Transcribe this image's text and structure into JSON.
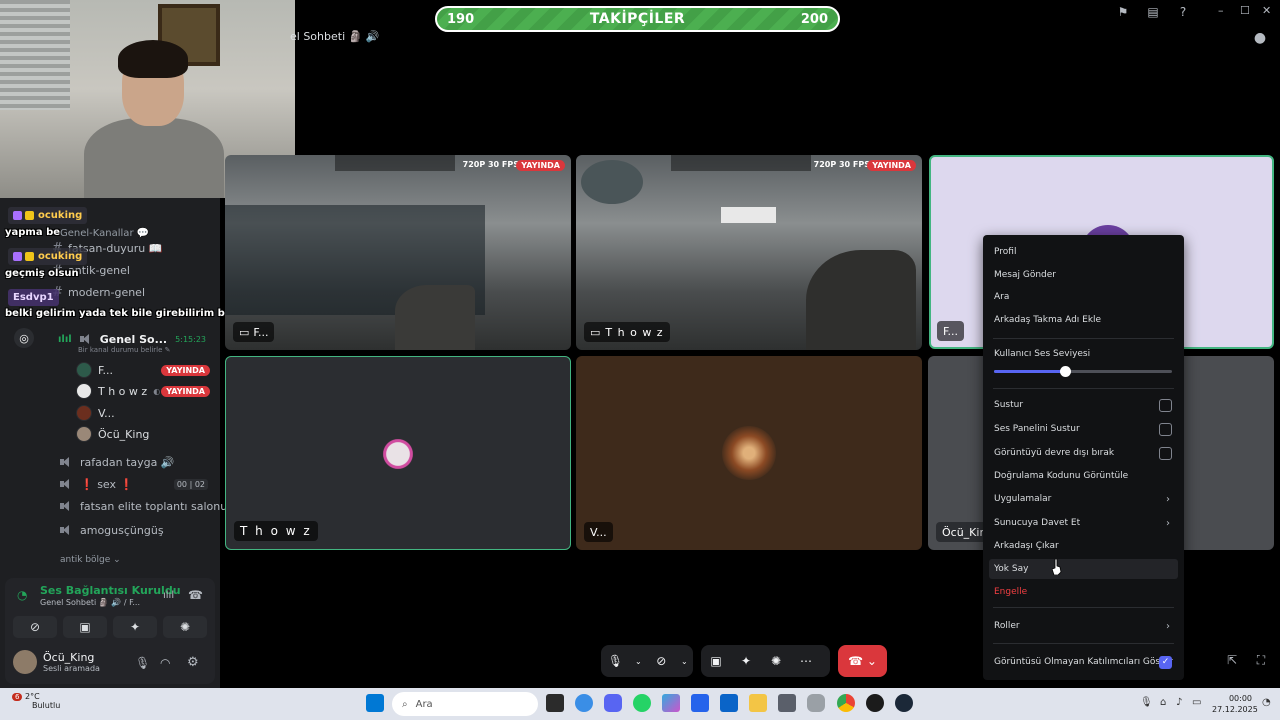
{
  "overlay": {
    "follower_min": "190",
    "follower_title": "TAKİPÇİLER",
    "follower_max": "200"
  },
  "channel_header": "el Sohbeti 🗿 🔊",
  "chat": [
    {
      "user": "ocuking",
      "message": "yapma be"
    },
    {
      "user": "ocuking",
      "message": "geçmiş olsun"
    },
    {
      "user": "Esdvp1",
      "message": "belki gelirim yada tek bile girebilirim bakıcaz duruma göre"
    }
  ],
  "sidebar": {
    "category_header": "Genel-Kanallar 💬",
    "text_channels": [
      "fatsan-duyuru 📖",
      "antik-genel",
      "modern-genel"
    ],
    "active_voice": {
      "name": "Genel So...",
      "time": "5:15:23",
      "status": "Bir kanal durumu belirle"
    },
    "voice_users": [
      {
        "name": "F...",
        "live": "YAYINDA"
      },
      {
        "name": "T h o w z",
        "live": "YAYINDA"
      },
      {
        "name": "V...",
        "live": ""
      },
      {
        "name": "Öcü_King",
        "live": ""
      }
    ],
    "other_voice": [
      {
        "name": "rafadan tayga 🔊",
        "count_a": "",
        "count_b": ""
      },
      {
        "name": "❗ sex ❗",
        "count_a": "00",
        "count_b": "02"
      },
      {
        "name": "fatsan elite toplantı salonu",
        "count_a": "",
        "count_b": ""
      },
      {
        "name": "amogusçüngüş",
        "count_a": "",
        "count_b": ""
      }
    ],
    "category_footer": "antik bölge"
  },
  "voice_panel": {
    "status": "Ses Bağlantısı Kuruldu",
    "sub": "Genel Sohbeti 🗿 🔊 / F...",
    "user": "Öcü_King",
    "user_state": "Sesli aramada"
  },
  "tiles": [
    {
      "label": "F...",
      "res": "720P 30 FPS",
      "live": "YAYINDA"
    },
    {
      "label": "T h o w z",
      "res": "720P 30 FPS",
      "live": "YAYINDA"
    },
    {
      "label": "F...",
      "res": "",
      "live": ""
    },
    {
      "label": "T h o w z",
      "res": "",
      "live": ""
    },
    {
      "label": "V...",
      "res": "",
      "live": ""
    },
    {
      "label": "Öcü_King",
      "res": "",
      "live": ""
    }
  ],
  "context_menu": {
    "items": [
      "Profil",
      "Mesaj Gönder",
      "Ara",
      "Arkadaş Takma Adı Ekle"
    ],
    "volume_label": "Kullanıcı Ses Seviyesi",
    "volume_level": 0.4,
    "toggles": [
      "Sustur",
      "Ses Panelini Sustur",
      "Görüntüyü devre dışı bırak"
    ],
    "verify": "Doğrulama Kodunu Görüntüle",
    "apps": "Uygulamalar",
    "invite": "Sunucuya Davet Et",
    "remove_friend": "Arkadaşı Çıkar",
    "ignore": "Yok Say",
    "block": "Engelle",
    "roles": "Roller",
    "show_nonvideo": "Görüntüsü Olmayan Katılımcıları Göster",
    "show_nonvideo_checked": true
  },
  "taskbar": {
    "weather_temp": "2°C",
    "weather_desc": "Bulutlu",
    "search_placeholder": "Ara",
    "time": "00:00",
    "date": "27.12.2025",
    "notif_count": "6"
  },
  "colors": {
    "live_red": "#da373c",
    "accent_blurple": "#5865f2",
    "connected_green": "#23a55a",
    "speaking_border": "#43b581"
  }
}
